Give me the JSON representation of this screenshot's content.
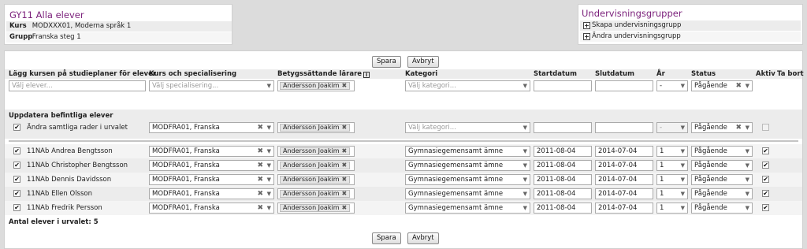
{
  "course": {
    "title": "GY11 Alla elever",
    "kurs_label": "Kurs",
    "kurs_value": "MODXXX01, Moderna språk 1",
    "grupp_label": "Grupp",
    "grupp_value": "Franska steg 1"
  },
  "groups": {
    "title": "Undervisningsgrupper",
    "create": "Skapa undervisningsgrupp",
    "edit": "Ändra undervisningsgrupp"
  },
  "buttons": {
    "save": "Spara",
    "cancel": "Avbryt"
  },
  "columns": {
    "studieplan": "Lägg kursen på studieplaner för elever",
    "kurs": "Kurs och specialisering",
    "larare": "Betygssättande lärare",
    "info_symbol": "i",
    "kategori": "Kategori",
    "startdatum": "Startdatum",
    "slutdatum": "Slutdatum",
    "ar": "År",
    "status": "Status",
    "aktiv": "Aktiv",
    "ta_bort": "Ta bort"
  },
  "add_row": {
    "elever_placeholder": "Välj elever...",
    "specialisering_placeholder": "Välj specialisering...",
    "teacher": "Andersson Joakim",
    "kategori_placeholder": "Välj kategori...",
    "ar": "-",
    "status": "Pågående"
  },
  "update_section": {
    "title": "Uppdatera befintliga elever",
    "all_label": "Ändra samtliga rader i urvalet",
    "kurs": "MODFRA01, Franska",
    "teacher": "Andersson Joakim",
    "kategori_placeholder": "Välj kategori...",
    "ar": "-",
    "status": "Pågående"
  },
  "students": [
    {
      "label": "11NAb Andrea Bengtsson",
      "kurs": "MODFRA01, Franska",
      "teacher": "Andersson Joakim",
      "kategori": "Gymnasiegemensamt ämne",
      "start": "2011-08-04",
      "slut": "2014-07-04",
      "ar": "1",
      "status": "Pågående"
    },
    {
      "label": "11NAb Christopher Bengtsson",
      "kurs": "MODFRA01, Franska",
      "teacher": "Andersson Joakim",
      "kategori": "Gymnasiegemensamt ämne",
      "start": "2011-08-04",
      "slut": "2014-07-04",
      "ar": "1",
      "status": "Pågående"
    },
    {
      "label": "11NAb Dennis Davidsson",
      "kurs": "MODFRA01, Franska",
      "teacher": "Andersson Joakim",
      "kategori": "Gymnasiegemensamt ämne",
      "start": "2011-08-04",
      "slut": "2014-07-04",
      "ar": "1",
      "status": "Pågående"
    },
    {
      "label": "11NAb Ellen Olsson",
      "kurs": "MODFRA01, Franska",
      "teacher": "Andersson Joakim",
      "kategori": "Gymnasiegemensamt ämne",
      "start": "2011-08-04",
      "slut": "2014-07-04",
      "ar": "1",
      "status": "Pågående"
    },
    {
      "label": "11NAb Fredrik Persson",
      "kurs": "MODFRA01, Franska",
      "teacher": "Andersson Joakim",
      "kategori": "Gymnasiegemensamt ämne",
      "start": "2011-08-04",
      "slut": "2014-07-04",
      "ar": "1",
      "status": "Pågående"
    }
  ],
  "count_label": "Antal elever i urvalet: 5",
  "icons": {
    "check": "✔",
    "clear": "✖",
    "dropdown": "▼",
    "plus": "+"
  }
}
